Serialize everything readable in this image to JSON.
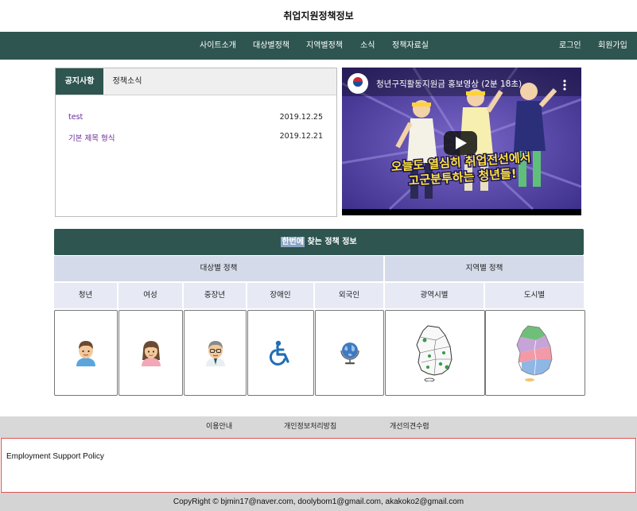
{
  "site_title": "취업지원정책정보",
  "nav": {
    "items": [
      "사이트소개",
      "대상별정책",
      "지역별정책",
      "소식",
      "정책자료실"
    ],
    "login": "로그인",
    "signup": "회원가입"
  },
  "notice_board": {
    "tabs": [
      "공지사항",
      "정책소식"
    ],
    "posts": [
      {
        "title": "test",
        "date": "2019.12.25"
      },
      {
        "title": "기본 제목 형식",
        "date": "2019.12.21"
      }
    ]
  },
  "video": {
    "title": "청년구직활동지원금 홍보영상 (2분 18초)",
    "caption_line1": "오늘도 열심히 취업전선에서",
    "caption_line2": "고군분투하는 청년들!",
    "channel_logo": "고용노동부"
  },
  "finder": {
    "heading_highlight": "한번에",
    "heading_rest": " 찾는 정책 정보",
    "group_target": "대상별 정책",
    "group_region": "지역별 정책",
    "categories": [
      {
        "label": "청년",
        "icon": "young-man-icon"
      },
      {
        "label": "여성",
        "icon": "woman-icon"
      },
      {
        "label": "중장년",
        "icon": "middle-aged-man-icon"
      },
      {
        "label": "장애인",
        "icon": "wheelchair-icon"
      },
      {
        "label": "외국인",
        "icon": "globe-icon"
      },
      {
        "label": "광역시별",
        "icon": "korea-map-metro-icon"
      },
      {
        "label": "도시별",
        "icon": "korea-map-city-icon"
      }
    ]
  },
  "footer": {
    "links": [
      "이용안내",
      "개인정보처리방침",
      "개선의견수렴"
    ],
    "policy_text": "Employment Support Policy",
    "copyright": "CopyRight © bjmin17@naver.com, doolybom1@gmail.com, akakoko2@gmail.com"
  },
  "colors": {
    "primary": "#2e5550",
    "group_bg": "#d4dae9",
    "category_bg": "#e7e9f5",
    "link_purple": "#6a2a98"
  }
}
